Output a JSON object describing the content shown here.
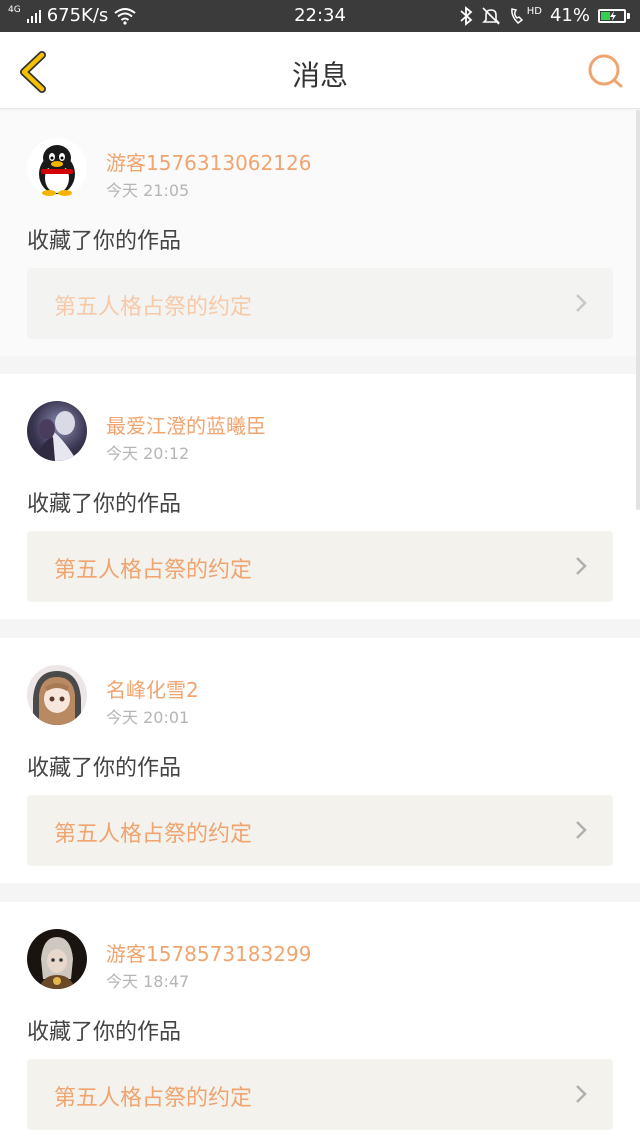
{
  "status_bar": {
    "network": "4G",
    "speed": "675K/s",
    "time": "22:34",
    "hd": "HD",
    "battery_percent": "41%",
    "battery_level": 0.41
  },
  "header": {
    "title": "消息",
    "back_icon": "chevron-left-icon",
    "search_icon": "search-icon",
    "accent_color": "#f0a470",
    "back_color": "#f5c000"
  },
  "messages": [
    {
      "user": "游客1576313062126",
      "time": "今天 21:05",
      "action": "收藏了你的作品",
      "work_title": "第五人格占祭的约定"
    },
    {
      "user": "最爱江澄的蓝曦臣",
      "time": "今天 20:12",
      "action": "收藏了你的作品",
      "work_title": "第五人格占祭的约定"
    },
    {
      "user": "名峰化雪2",
      "time": "今天 20:01",
      "action": "收藏了你的作品",
      "work_title": "第五人格占祭的约定"
    },
    {
      "user": "游客1578573183299",
      "time": "今天 18:47",
      "action": "收藏了你的作品",
      "work_title": "第五人格占祭的约定"
    }
  ]
}
